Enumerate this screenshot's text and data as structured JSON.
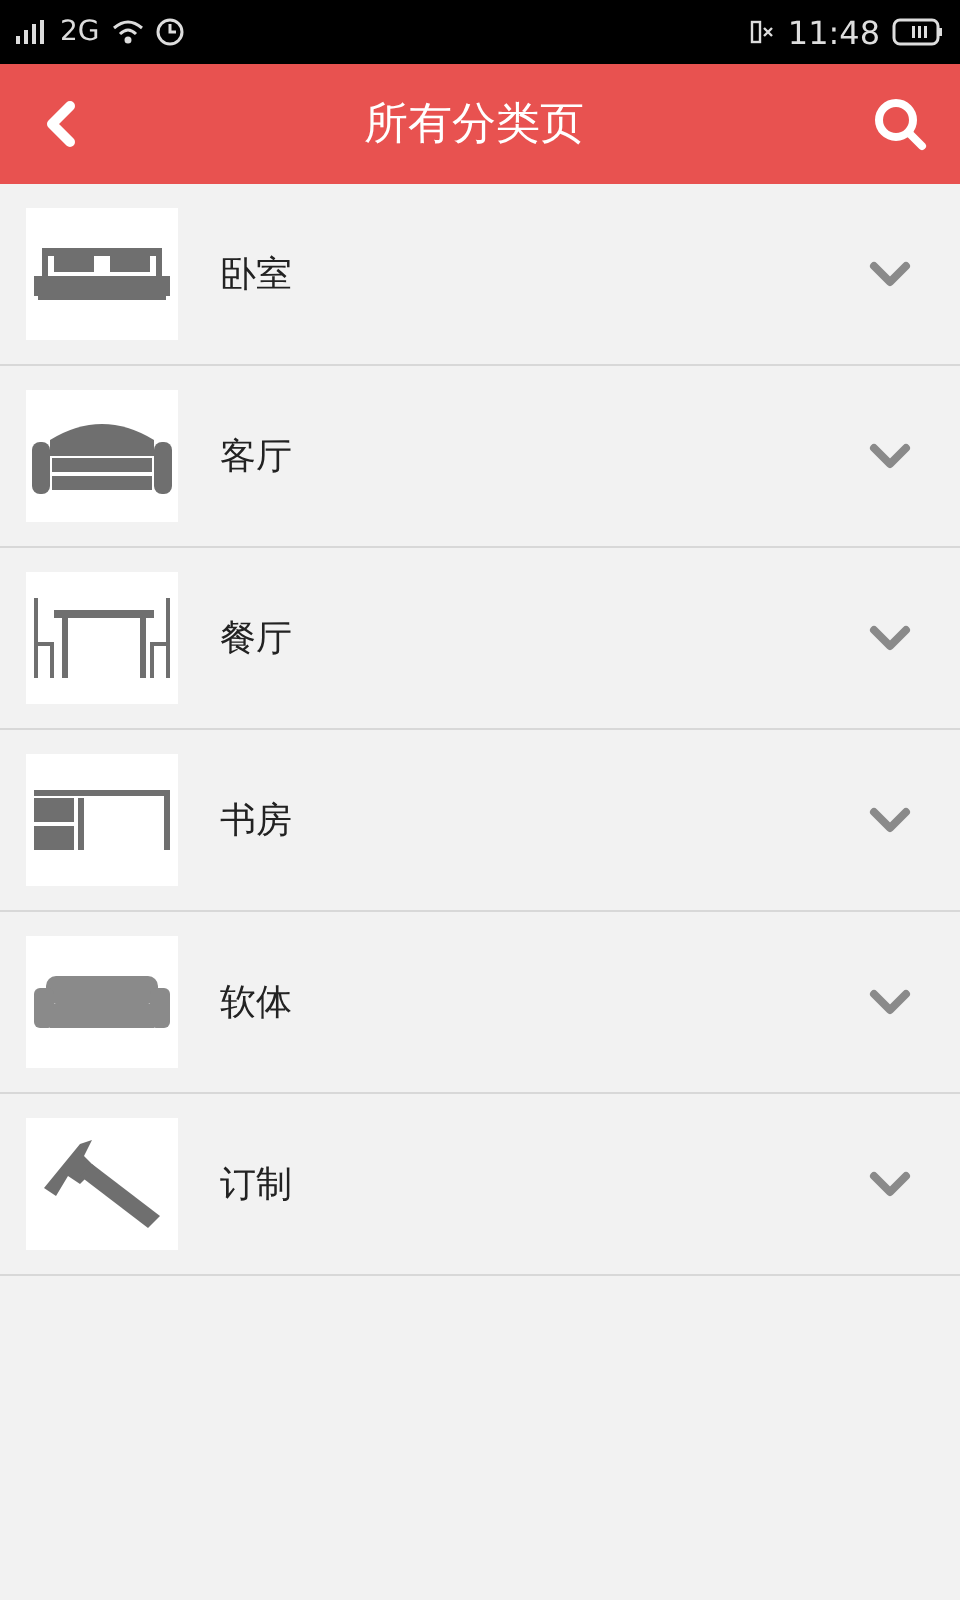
{
  "status_bar": {
    "network": "2G",
    "time": "11:48"
  },
  "header": {
    "title": "所有分类页"
  },
  "categories": [
    {
      "label": "卧室",
      "expanded": false
    },
    {
      "label": "客厅",
      "expanded": false
    },
    {
      "label": "餐厅",
      "expanded": false
    },
    {
      "label": "书房",
      "expanded": false
    },
    {
      "label": "软体",
      "expanded": false
    },
    {
      "label": "订制",
      "expanded": false
    }
  ]
}
